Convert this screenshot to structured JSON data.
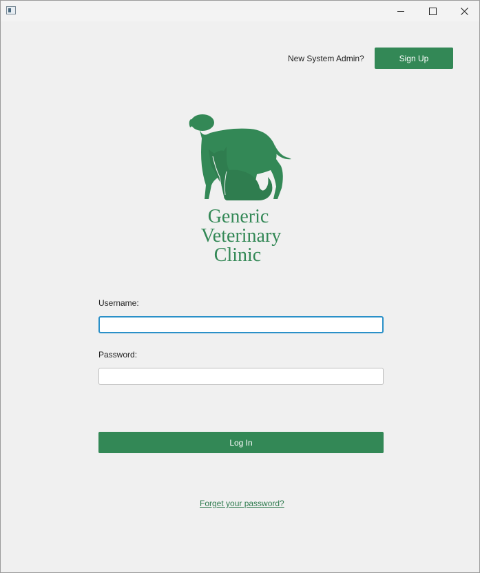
{
  "window": {
    "controls": {
      "minimize_icon": "minimize-icon",
      "maximize_icon": "maximize-icon",
      "close_icon": "close-icon"
    }
  },
  "header": {
    "admin_prompt": "New System Admin?",
    "signup_label": "Sign Up"
  },
  "logo": {
    "line1": "Generic",
    "line2": "Veterinary",
    "line3": "Clinic",
    "color": "#338856"
  },
  "form": {
    "username_label": "Username:",
    "username_value": "",
    "password_label": "Password:",
    "password_value": "",
    "login_label": "Log In",
    "forgot_label": "Forget your password?"
  },
  "colors": {
    "accent": "#338856",
    "focus_border": "#2a90c8",
    "background": "#f0f0f0"
  }
}
